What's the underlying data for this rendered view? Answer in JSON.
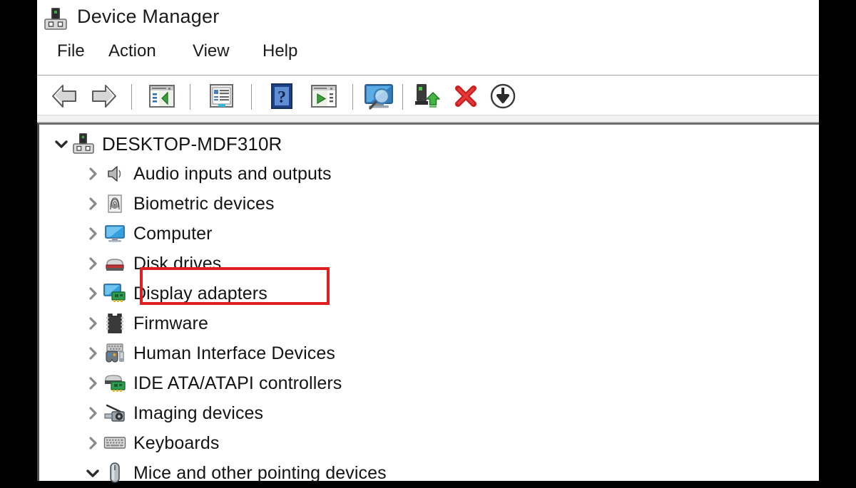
{
  "window": {
    "title": "Device Manager",
    "title_icon": "device-manager-icon"
  },
  "menubar": {
    "items": [
      {
        "label": "File",
        "name": "menu-file"
      },
      {
        "label": "Action",
        "name": "menu-action"
      },
      {
        "label": "View",
        "name": "menu-view"
      },
      {
        "label": "Help",
        "name": "menu-help"
      }
    ]
  },
  "toolbar": {
    "buttons": [
      {
        "name": "back-arrow-icon",
        "tooltip": "Back"
      },
      {
        "name": "forward-arrow-icon",
        "tooltip": "Forward"
      },
      {
        "name": "show-hide-console-tree-icon",
        "tooltip": "Show/Hide Console Tree"
      },
      {
        "name": "properties-icon",
        "tooltip": "Properties"
      },
      {
        "name": "help-icon",
        "tooltip": "Help"
      },
      {
        "name": "update-driver-icon",
        "tooltip": "Update driver"
      },
      {
        "name": "scan-for-hardware-changes-icon",
        "tooltip": "Scan for hardware changes"
      },
      {
        "name": "enable-device-icon",
        "tooltip": "Enable device"
      },
      {
        "name": "uninstall-device-icon",
        "tooltip": "Uninstall device"
      },
      {
        "name": "disable-device-icon",
        "tooltip": "Disable device"
      }
    ]
  },
  "tree": {
    "root": {
      "label": "DESKTOP-MDF310R",
      "expanded": true,
      "icon": "computer-device-icon"
    },
    "items": [
      {
        "label": "Audio inputs and outputs",
        "icon": "speaker-icon",
        "expanded": false,
        "highlighted": false
      },
      {
        "label": "Biometric devices",
        "icon": "fingerprint-icon",
        "expanded": false,
        "highlighted": false
      },
      {
        "label": "Computer",
        "icon": "monitor-icon",
        "expanded": false,
        "highlighted": false
      },
      {
        "label": "Disk drives",
        "icon": "disk-drive-icon",
        "expanded": false,
        "highlighted": false
      },
      {
        "label": "Display adapters",
        "icon": "display-adapter-icon",
        "expanded": false,
        "highlighted": true
      },
      {
        "label": "Firmware",
        "icon": "chip-icon",
        "expanded": false,
        "highlighted": false
      },
      {
        "label": "Human Interface Devices",
        "icon": "hid-icon",
        "expanded": false,
        "highlighted": false
      },
      {
        "label": "IDE ATA/ATAPI controllers",
        "icon": "ide-controller-icon",
        "expanded": false,
        "highlighted": false
      },
      {
        "label": "Imaging devices",
        "icon": "camera-icon",
        "expanded": false,
        "highlighted": false
      },
      {
        "label": "Keyboards",
        "icon": "keyboard-icon",
        "expanded": false,
        "highlighted": false
      },
      {
        "label": "Mice and other pointing devices",
        "icon": "mouse-icon",
        "expanded": true,
        "highlighted": false
      }
    ]
  },
  "annotation": {
    "highlight_color": "#e02020",
    "highlight_target": "Display adapters"
  }
}
